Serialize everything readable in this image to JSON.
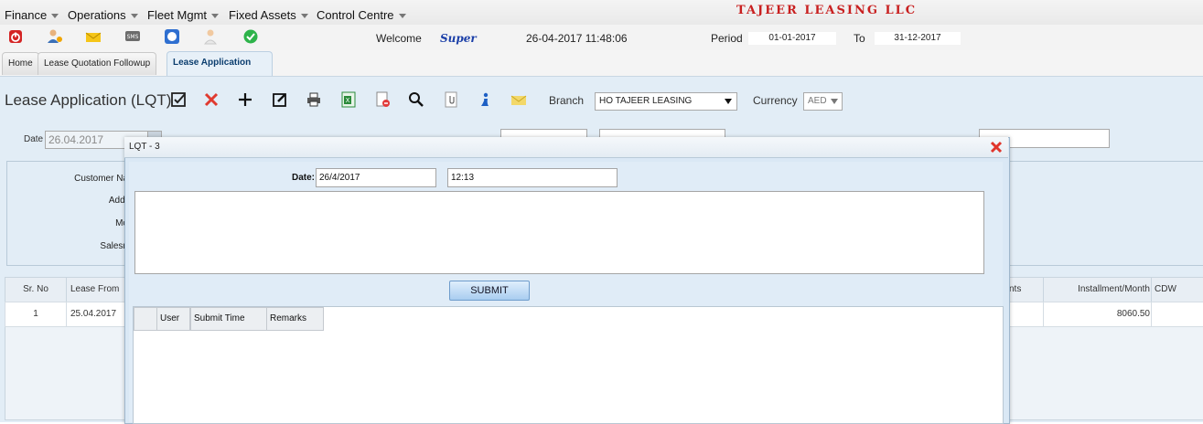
{
  "menu": {
    "items": [
      "Finance",
      "Operations",
      "Fleet Mgmt",
      "Fixed Assets",
      "Control Centre"
    ],
    "company_name": "TAJEER LEASING LLC"
  },
  "topbar": {
    "welcome_label": "Welcome",
    "user": "Super",
    "datetime": "26-04-2017 11:48:06",
    "period_label": "Period",
    "period_from": "01-01-2017",
    "to_label": "To",
    "period_to": "31-12-2017",
    "icons": [
      "power-icon",
      "user-settings-icon",
      "mail-icon",
      "sms-icon",
      "chat-icon",
      "help-user-icon",
      "approve-check-icon"
    ]
  },
  "tabs": [
    {
      "label": "Home",
      "active": false
    },
    {
      "label": "Lease Quotation Followup",
      "active": false
    },
    {
      "label": "Lease Application",
      "active": true
    }
  ],
  "page": {
    "title": "Lease Application (LQT)",
    "toolbar_icons": [
      "save-check-icon",
      "delete-x-icon",
      "add-plus-icon",
      "edit-icon",
      "print-icon",
      "excel-export-icon",
      "cancel-doc-icon",
      "search-icon",
      "attach-icon",
      "info-icon",
      "mail-icon"
    ],
    "branch_label": "Branch",
    "branch_value": "HO TAJEER LEASING",
    "currency_label": "Currency",
    "currency_value": "AED",
    "date_label": "Date",
    "date_value": "26.04.2017",
    "customer_fields": [
      "Customer Na",
      "Addr",
      "Mo",
      "Salesn"
    ]
  },
  "grid": {
    "headers": [
      "Sr. No",
      "Lease From",
      "nts",
      "Installment/Month",
      "CDW"
    ],
    "row": {
      "sr": "1",
      "lease_from": "25.04.2017",
      "installment": "8060.50"
    }
  },
  "dialog": {
    "title": "LQT - 3",
    "date_label": "Date:",
    "date_value": "26/4/2017",
    "time_value": "12:13",
    "submit_label": "SUBMIT",
    "history_headers": [
      "User",
      "Submit Time",
      "Remarks"
    ]
  },
  "colors": {
    "company_red": "#c81f1f",
    "panel_blue": "#e2edf6",
    "submit_blue": "#a9cdf0"
  }
}
